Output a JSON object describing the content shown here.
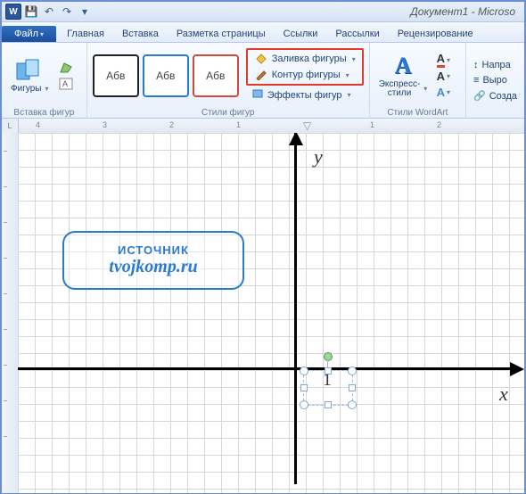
{
  "app_icon_letter": "W",
  "title": "Документ1 - Microso",
  "qat": {
    "save": "💾",
    "undo": "↶",
    "redo": "↷",
    "dd": "▾"
  },
  "tabs": {
    "file": "Файл",
    "home": "Главная",
    "insert": "Вставка",
    "layout": "Разметка страницы",
    "refs": "Ссылки",
    "mail": "Рассылки",
    "review": "Рецензирование"
  },
  "ribbon": {
    "shapes": {
      "label": "Фигуры",
      "group_label": "Вставка фигур"
    },
    "styles": {
      "sample": "Абв",
      "group_label": "Стили фигур",
      "fill": "Заливка фигуры",
      "outline": "Контур фигуры",
      "effects": "Эффекты фигур"
    },
    "wordart": {
      "label": "Экспресс-\nстили",
      "group_label": "Стили WordArt",
      "glyph": "A"
    },
    "editing": {
      "direction": "Напра",
      "align": "Выро",
      "create": "Созда"
    }
  },
  "ruler": {
    "corner": "L",
    "marks": [
      "4",
      "3",
      "2",
      "1",
      "",
      "1",
      "2"
    ]
  },
  "axes": {
    "y": "y",
    "x": "x",
    "one": "1"
  },
  "watermark": {
    "line1": "ИСТОЧНИК",
    "line2": "tvojkomp.ru"
  }
}
